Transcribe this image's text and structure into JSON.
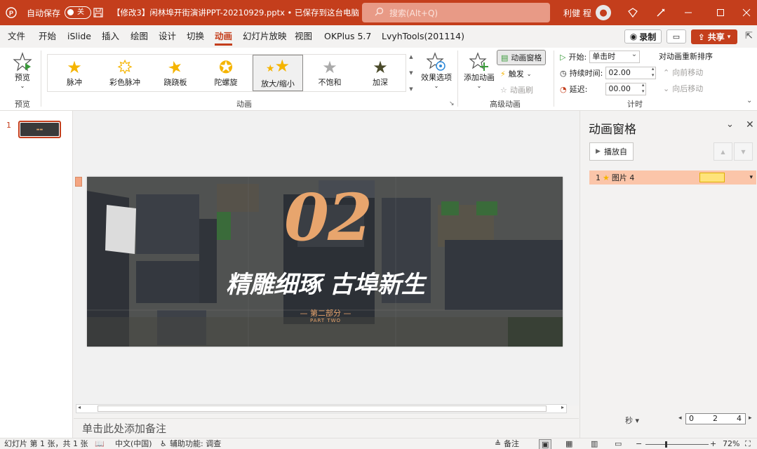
{
  "titlebar": {
    "autosave_label": "自动保存",
    "autosave_state": "关",
    "doc_title": "【修改3】闲林埠开街演讲PPT-20210929.pptx • 已保存到这台电脑",
    "search_placeholder": "搜索(Alt+Q)",
    "user_name": "利健 程"
  },
  "menu": {
    "items": [
      "文件",
      "开始",
      "iSlide",
      "插入",
      "绘图",
      "设计",
      "切换",
      "动画",
      "幻灯片放映",
      "视图",
      "OKPlus 5.7",
      "LvyhTools(201114)"
    ],
    "active": "动画",
    "record_label": "录制",
    "share_label": "共享"
  },
  "ribbon": {
    "preview_label": "预览",
    "preview_group": "预览",
    "animation_group": "动画",
    "effects": [
      "脉冲",
      "彩色脉冲",
      "跷跷板",
      "陀螺旋",
      "放大/缩小",
      "不饱和",
      "加深"
    ],
    "selected_effect": "放大/缩小",
    "effect_options": "效果选项",
    "add_animation": "添加动画",
    "animation_pane_btn": "动画窗格",
    "trigger": "触发",
    "anim_painter": "动画刷",
    "advanced_group": "高级动画",
    "start_label": "开始:",
    "start_value": "单击时",
    "duration_label": "持续时间:",
    "duration_value": "02.00",
    "delay_label": "延迟:",
    "delay_value": "00.00",
    "timing_group": "计时",
    "reorder_title": "对动画重新排序",
    "move_earlier": "向前移动",
    "move_later": "向后移动"
  },
  "thumbnails": {
    "slide_number": "1"
  },
  "slide": {
    "number_big": "02",
    "headline": "精雕细琢  古埠新生",
    "subtitle": "— 第二部分 —",
    "subtitle_en": "PART TWO"
  },
  "notes": {
    "placeholder": "单击此处添加备注"
  },
  "anim_pane": {
    "title": "动画窗格",
    "play_from": "播放自",
    "item_index": "1",
    "item_name": "图片 4",
    "timeline_unit": "秒",
    "timeline_ticks": [
      "0",
      "2",
      "4"
    ]
  },
  "status": {
    "slide_info": "幻灯片 第 1 张，共 1 张",
    "language": "中文(中国)",
    "accessibility": "辅助功能: 调查",
    "notes_btn": "备注",
    "zoom": "72%"
  },
  "colors": {
    "accent": "#c43e1c",
    "slide_number_color": "#e8a56d"
  }
}
